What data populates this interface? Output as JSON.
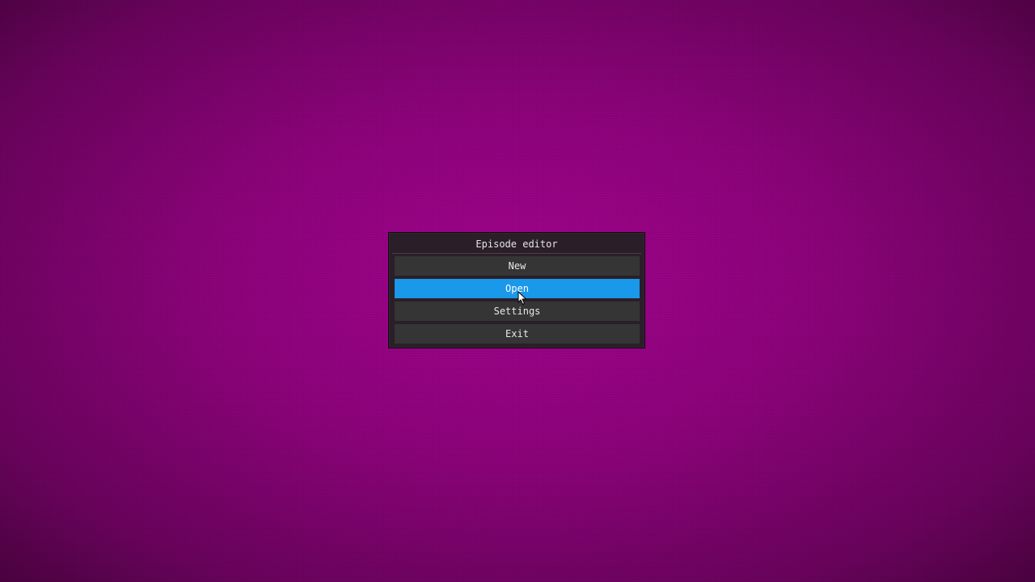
{
  "dialog": {
    "title": "Episode editor",
    "buttons": {
      "new": "New",
      "open": "Open",
      "settings": "Settings",
      "exit": "Exit"
    },
    "highlighted": "open"
  },
  "colors": {
    "background": "#a4038f",
    "panel": "#2a1f29",
    "button": "#353535",
    "button_highlight": "#1a98ea",
    "text": "#e8e8e8"
  },
  "icons": {
    "cursor": "arrow-cursor-icon"
  }
}
